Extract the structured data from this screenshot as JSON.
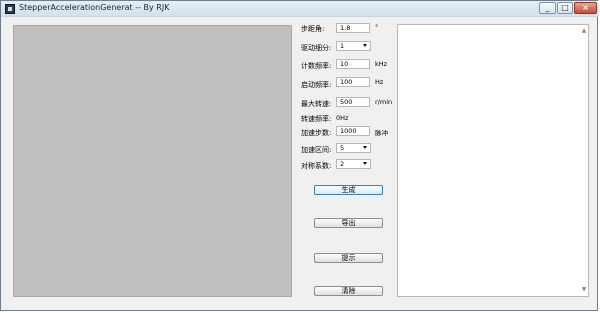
{
  "window": {
    "title": "StepperAccelerationGenerat -- By RJK",
    "minimize_icon": "_",
    "maximize_icon": "□",
    "close_icon": "×"
  },
  "form": {
    "step_angle": {
      "label": "步距角:",
      "value": "1.8",
      "unit": "°"
    },
    "microstep": {
      "label": "驱动细分:",
      "value": "1"
    },
    "count_frequency": {
      "label": "计数频率:",
      "value": "10",
      "unit": "kHz"
    },
    "start_frequency": {
      "label": "启动频率:",
      "value": "100",
      "unit": "Hz"
    },
    "max_speed": {
      "label": "最大转速:",
      "value": "500",
      "unit": "r/min"
    },
    "speed_frequency": {
      "label": "转速频率:",
      "value": "0Hz"
    },
    "accel_steps": {
      "label": "加速步数:",
      "value": "1000",
      "unit": "脉冲"
    },
    "accel_interval": {
      "label": "加速区间:",
      "value": "5"
    },
    "symmetry_factor": {
      "label": "对称系数:",
      "value": "2"
    }
  },
  "buttons": {
    "generate": "生成",
    "export": "导出",
    "hint": "提示",
    "clear": "清除"
  },
  "output": {
    "scroll_up_icon": "▲",
    "scroll_down_icon": "▼"
  }
}
